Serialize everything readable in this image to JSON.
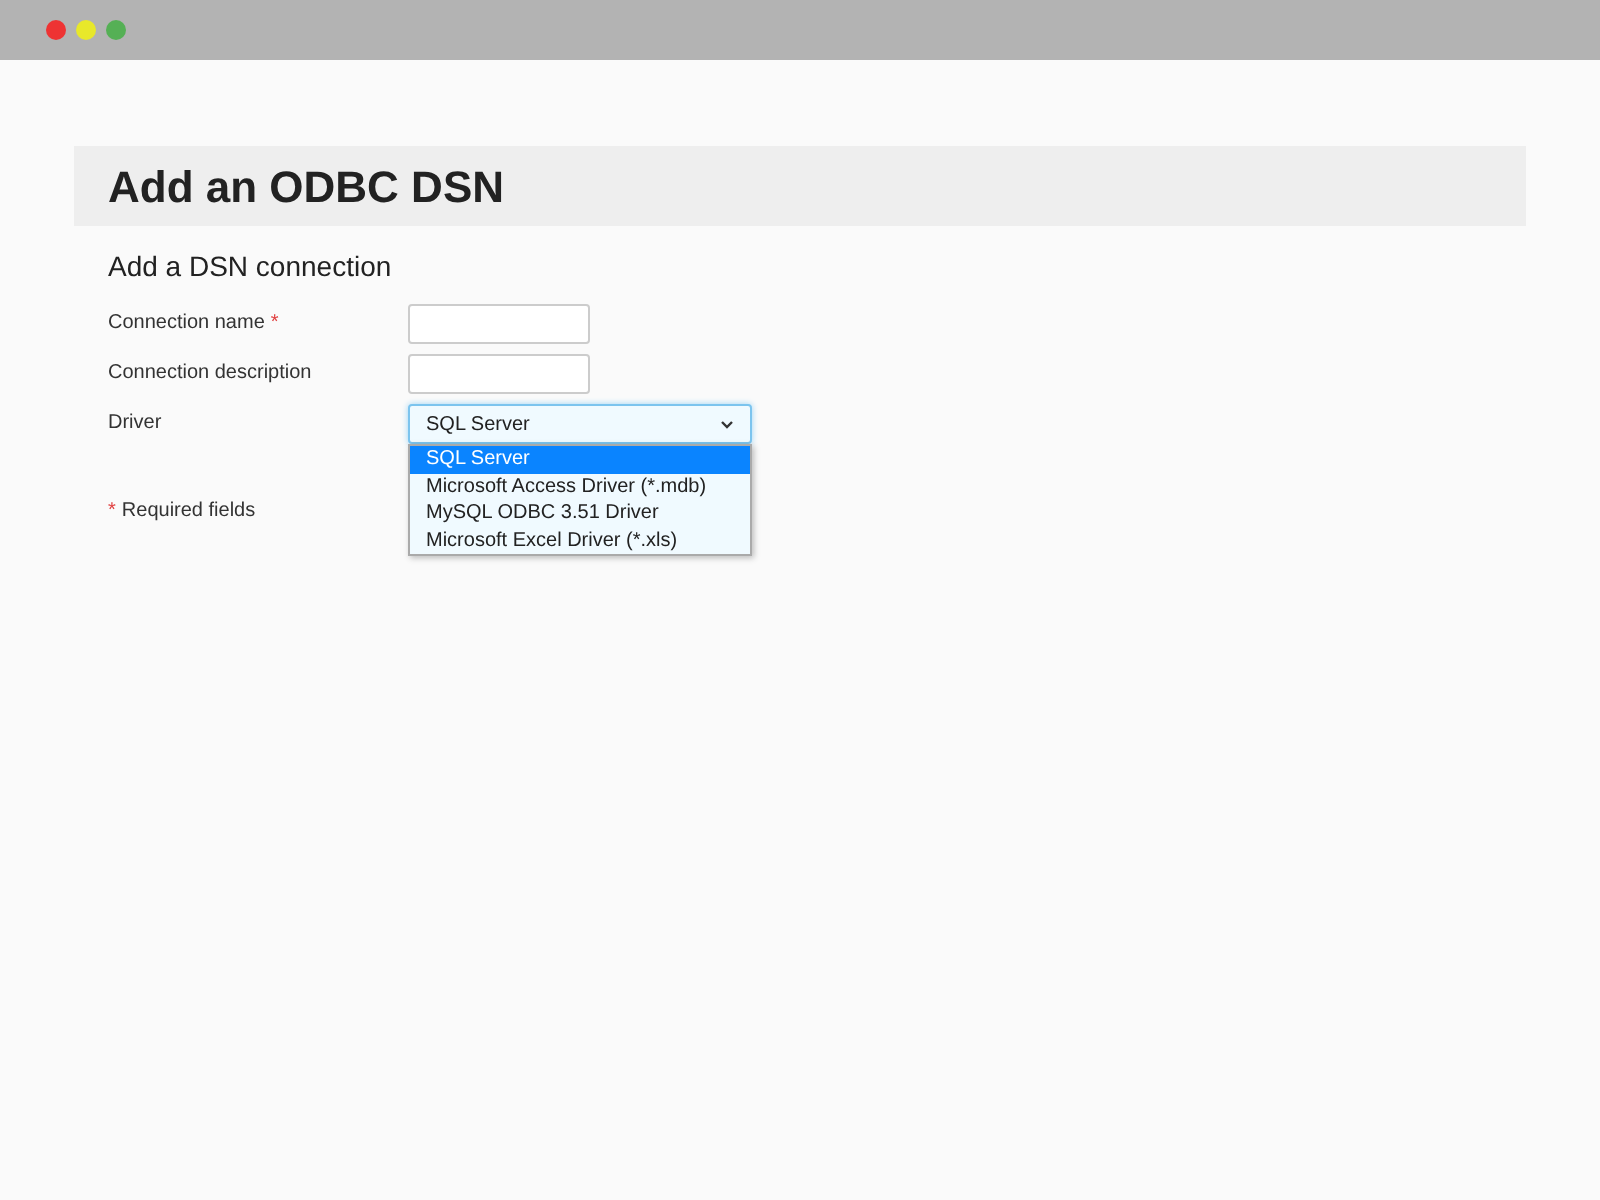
{
  "page": {
    "title": "Add an ODBC DSN",
    "subtitle": "Add a DSN connection"
  },
  "fields": [
    {
      "kind": "text",
      "label": "Connection name",
      "required_mark": "*"
    },
    {
      "kind": "text",
      "label": "Connection description"
    },
    {
      "kind": "select",
      "label": "Driver",
      "value": "SQL Server",
      "expanded": true,
      "options": [
        {
          "label": "SQL Server",
          "selected": true
        },
        {
          "label": "Microsoft Access Driver (*.mdb)",
          "selected": false
        },
        {
          "label": "MySQL ODBC 3.51 Driver",
          "selected": false
        },
        {
          "label": "Microsoft Excel Driver (*.xls)",
          "selected": false
        }
      ]
    }
  ],
  "footnote": {
    "mark": "*",
    "text": "Required fields"
  }
}
